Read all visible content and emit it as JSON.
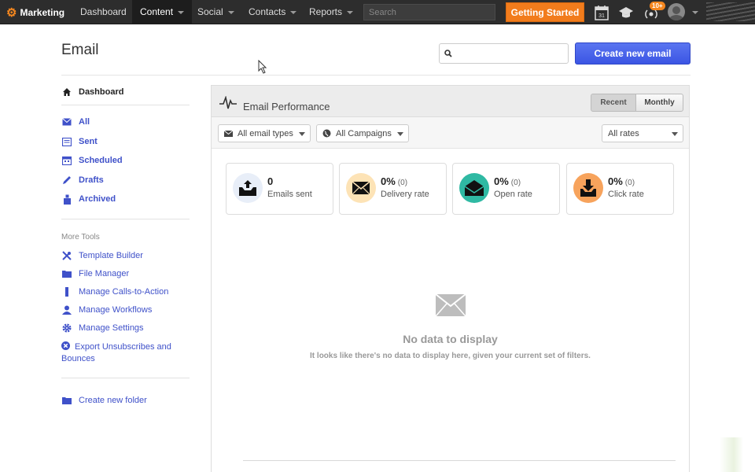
{
  "topnav": {
    "brand": "Marketing",
    "items": [
      {
        "label": "Dashboard",
        "dropdown": false,
        "active": false
      },
      {
        "label": "Content",
        "dropdown": true,
        "active": true
      },
      {
        "label": "Social",
        "dropdown": true,
        "active": false
      },
      {
        "label": "Contacts",
        "dropdown": true,
        "active": false
      },
      {
        "label": "Reports",
        "dropdown": true,
        "active": false
      }
    ],
    "search_placeholder": "Search",
    "getting_started": "Getting Started",
    "calendar_day": "31",
    "notifications_count": "10+"
  },
  "header": {
    "title": "Email",
    "search_placeholder": "",
    "create_button": "Create new email"
  },
  "sidebar": {
    "dashboard": "Dashboard",
    "items": [
      "All",
      "Sent",
      "Scheduled",
      "Drafts",
      "Archived"
    ],
    "more_tools_heading": "More Tools",
    "tools": [
      "Template Builder",
      "File Manager",
      "Manage Calls-to-Action",
      "Manage Workflows",
      "Manage Settings",
      "Export Unsubscribes and Bounces"
    ],
    "create_folder": "Create new folder"
  },
  "panel": {
    "title": "Email Performance",
    "toggle_recent": "Recent",
    "toggle_monthly": "Monthly",
    "filters": {
      "email_types": "All email types",
      "campaigns": "All Campaigns",
      "rates": "All rates"
    },
    "stats": [
      {
        "value": "0",
        "paren": "",
        "label": "Emails sent",
        "color": "#e8eef8"
      },
      {
        "value": "0%",
        "paren": "(0)",
        "label": "Delivery rate",
        "color": "#fde3b6"
      },
      {
        "value": "0%",
        "paren": "(0)",
        "label": "Open rate",
        "color": "#2fb9a3"
      },
      {
        "value": "0%",
        "paren": "(0)",
        "label": "Click rate",
        "color": "#f7a35c"
      }
    ],
    "empty_title": "No data to display",
    "empty_subtitle": "It looks like there's no data to display here, given your current set of filters."
  }
}
